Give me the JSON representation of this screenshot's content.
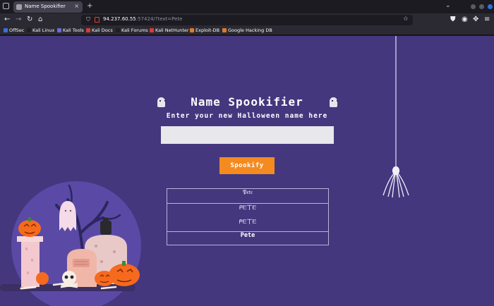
{
  "browser": {
    "tab_title": "Name Spookifier",
    "new_tab": "+",
    "close_tab": "×",
    "tabs_menu": "⌄",
    "url_host": "94.237.60.55",
    "url_rest": ":57424/?text=Pete",
    "bookmarks": [
      {
        "label": "OffSec",
        "color": "#3a6fd8"
      },
      {
        "label": "Kali Linux",
        "color": "#1f1f1f"
      },
      {
        "label": "Kali Tools",
        "color": "#6c6cd8"
      },
      {
        "label": "Kali Docs",
        "color": "#d83a3a"
      },
      {
        "label": "Kali Forums",
        "color": "#1f1f1f"
      },
      {
        "label": "Kali NetHunter",
        "color": "#d83a3a"
      },
      {
        "label": "Exploit-DB",
        "color": "#e07a2a"
      },
      {
        "label": "Google Hacking DB",
        "color": "#e07a2a"
      }
    ]
  },
  "page": {
    "title": "Name Spookifier",
    "subtitle": "Enter your new Halloween name here",
    "input_value": "",
    "button_label": "Spookify",
    "results": [
      "𝔓𝔢𝔱𝔢",
      "ᑭᗴ丅ᗴ",
      "ᖘᗴ丅ᗴ",
      "Pete"
    ]
  },
  "colors": {
    "background": "#44377e",
    "button": "#f58a1f",
    "input": "#e8e7ec"
  }
}
